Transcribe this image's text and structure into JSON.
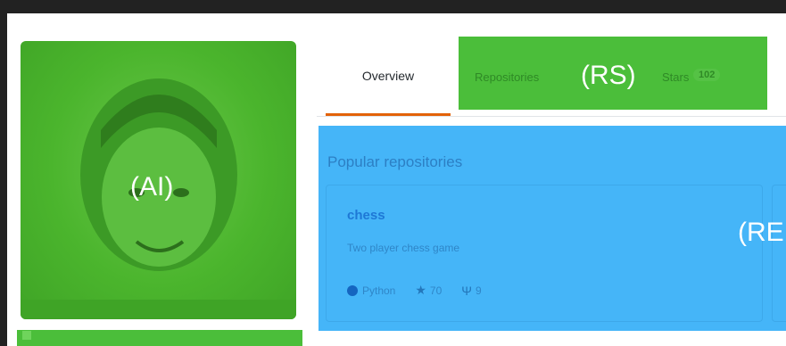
{
  "annotations": {
    "avatar": "(AI)",
    "repo_tabs": "(RS)",
    "repos": "(RE"
  },
  "tabs": {
    "overview": "Overview",
    "repositories": "Repositories",
    "stars": "Stars",
    "stars_count": "102"
  },
  "popular": {
    "title": "Popular repositories",
    "repo": {
      "name": "chess",
      "description": "Two player chess game",
      "language": "Python",
      "stars": "70",
      "forks": "9"
    }
  },
  "colors": {
    "accent_tab": "#e36209",
    "overlay_green": "#4bbe3a",
    "overlay_blue": "#45b5f8"
  }
}
